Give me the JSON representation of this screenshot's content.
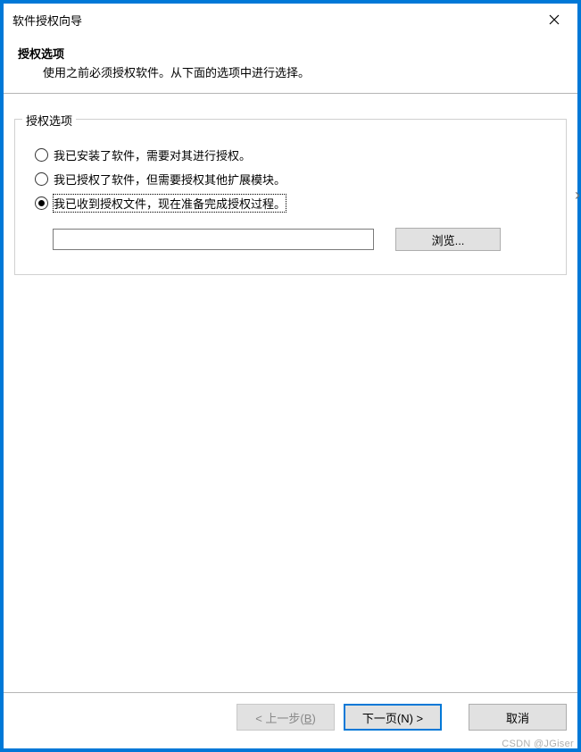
{
  "window": {
    "title": "软件授权向导"
  },
  "header": {
    "title": "授权选项",
    "subtitle": "使用之前必须授权软件。从下面的选项中进行选择。"
  },
  "group": {
    "legend": "授权选项",
    "options": [
      {
        "label": "我已安装了软件，需要对其进行授权。",
        "selected": false
      },
      {
        "label": "我已授权了软件，但需要授权其他扩展模块。",
        "selected": false
      },
      {
        "label": "我已收到授权文件，现在准备完成授权过程。",
        "selected": true
      }
    ],
    "file_value": "",
    "browse_label": "浏览..."
  },
  "footer": {
    "back_label": "< 上一步(B)",
    "next_label": "下一页(N) >",
    "cancel_label": "取消"
  },
  "watermark": "CSDN @JGiser"
}
